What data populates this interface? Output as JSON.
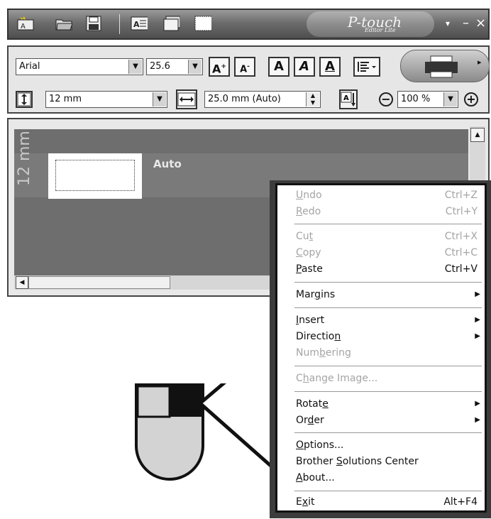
{
  "titlebar": {
    "app_logo": "P-touch",
    "app_sub": "Editor Lite",
    "icons": [
      "new-label-icon",
      "open-icon",
      "save-icon",
      "text-frame-icon",
      "layout-icon",
      "frame-icon"
    ],
    "controls": {
      "menu": "▾",
      "minimize": "–",
      "close": "×"
    }
  },
  "toolbar": {
    "font_name": "Arial",
    "font_size": "25.6",
    "tape_width": "12 mm",
    "length": "25.0 mm (Auto)",
    "zoom": "100 %",
    "format_buttons": [
      "A",
      "A",
      "A",
      "A",
      "A"
    ]
  },
  "editor": {
    "vertical_label": "12 mm",
    "auto_label": "Auto"
  },
  "menu": {
    "items": [
      {
        "pre": "",
        "u": "U",
        "post": "ndo",
        "shortcut": "Ctrl+Z",
        "disabled": true
      },
      {
        "pre": "",
        "u": "R",
        "post": "edo",
        "shortcut": "Ctrl+Y",
        "disabled": true
      },
      {
        "pre": "Cu",
        "u": "t",
        "post": "",
        "shortcut": "Ctrl+X",
        "disabled": true
      },
      {
        "pre": "",
        "u": "C",
        "post": "opy",
        "shortcut": "Ctrl+C",
        "disabled": true
      },
      {
        "pre": "",
        "u": "P",
        "post": "aste",
        "shortcut": "Ctrl+V",
        "disabled": false
      },
      {
        "pre": "Mar",
        "u": "g",
        "post": "ins",
        "shortcut": "",
        "disabled": false,
        "submenu": true
      },
      {
        "pre": "",
        "u": "I",
        "post": "nsert",
        "shortcut": "",
        "disabled": false,
        "submenu": true
      },
      {
        "pre": "Directio",
        "u": "n",
        "post": "",
        "shortcut": "",
        "disabled": false,
        "submenu": true
      },
      {
        "pre": "Num",
        "u": "b",
        "post": "ering",
        "shortcut": "",
        "disabled": true
      },
      {
        "pre": "C",
        "u": "h",
        "post": "ange Image...",
        "shortcut": "",
        "disabled": true
      },
      {
        "pre": "Rotat",
        "u": "e",
        "post": "",
        "shortcut": "",
        "disabled": false,
        "submenu": true
      },
      {
        "pre": "Or",
        "u": "d",
        "post": "er",
        "shortcut": "",
        "disabled": false,
        "submenu": true
      },
      {
        "pre": "",
        "u": "O",
        "post": "ptions...",
        "shortcut": "",
        "disabled": false
      },
      {
        "pre": "Brother ",
        "u": "S",
        "post": "olutions Center",
        "shortcut": "",
        "disabled": false
      },
      {
        "pre": "",
        "u": "A",
        "post": "bout...",
        "shortcut": "",
        "disabled": false
      },
      {
        "pre": "E",
        "u": "x",
        "post": "it",
        "shortcut": "Alt+F4",
        "disabled": false
      }
    ]
  }
}
